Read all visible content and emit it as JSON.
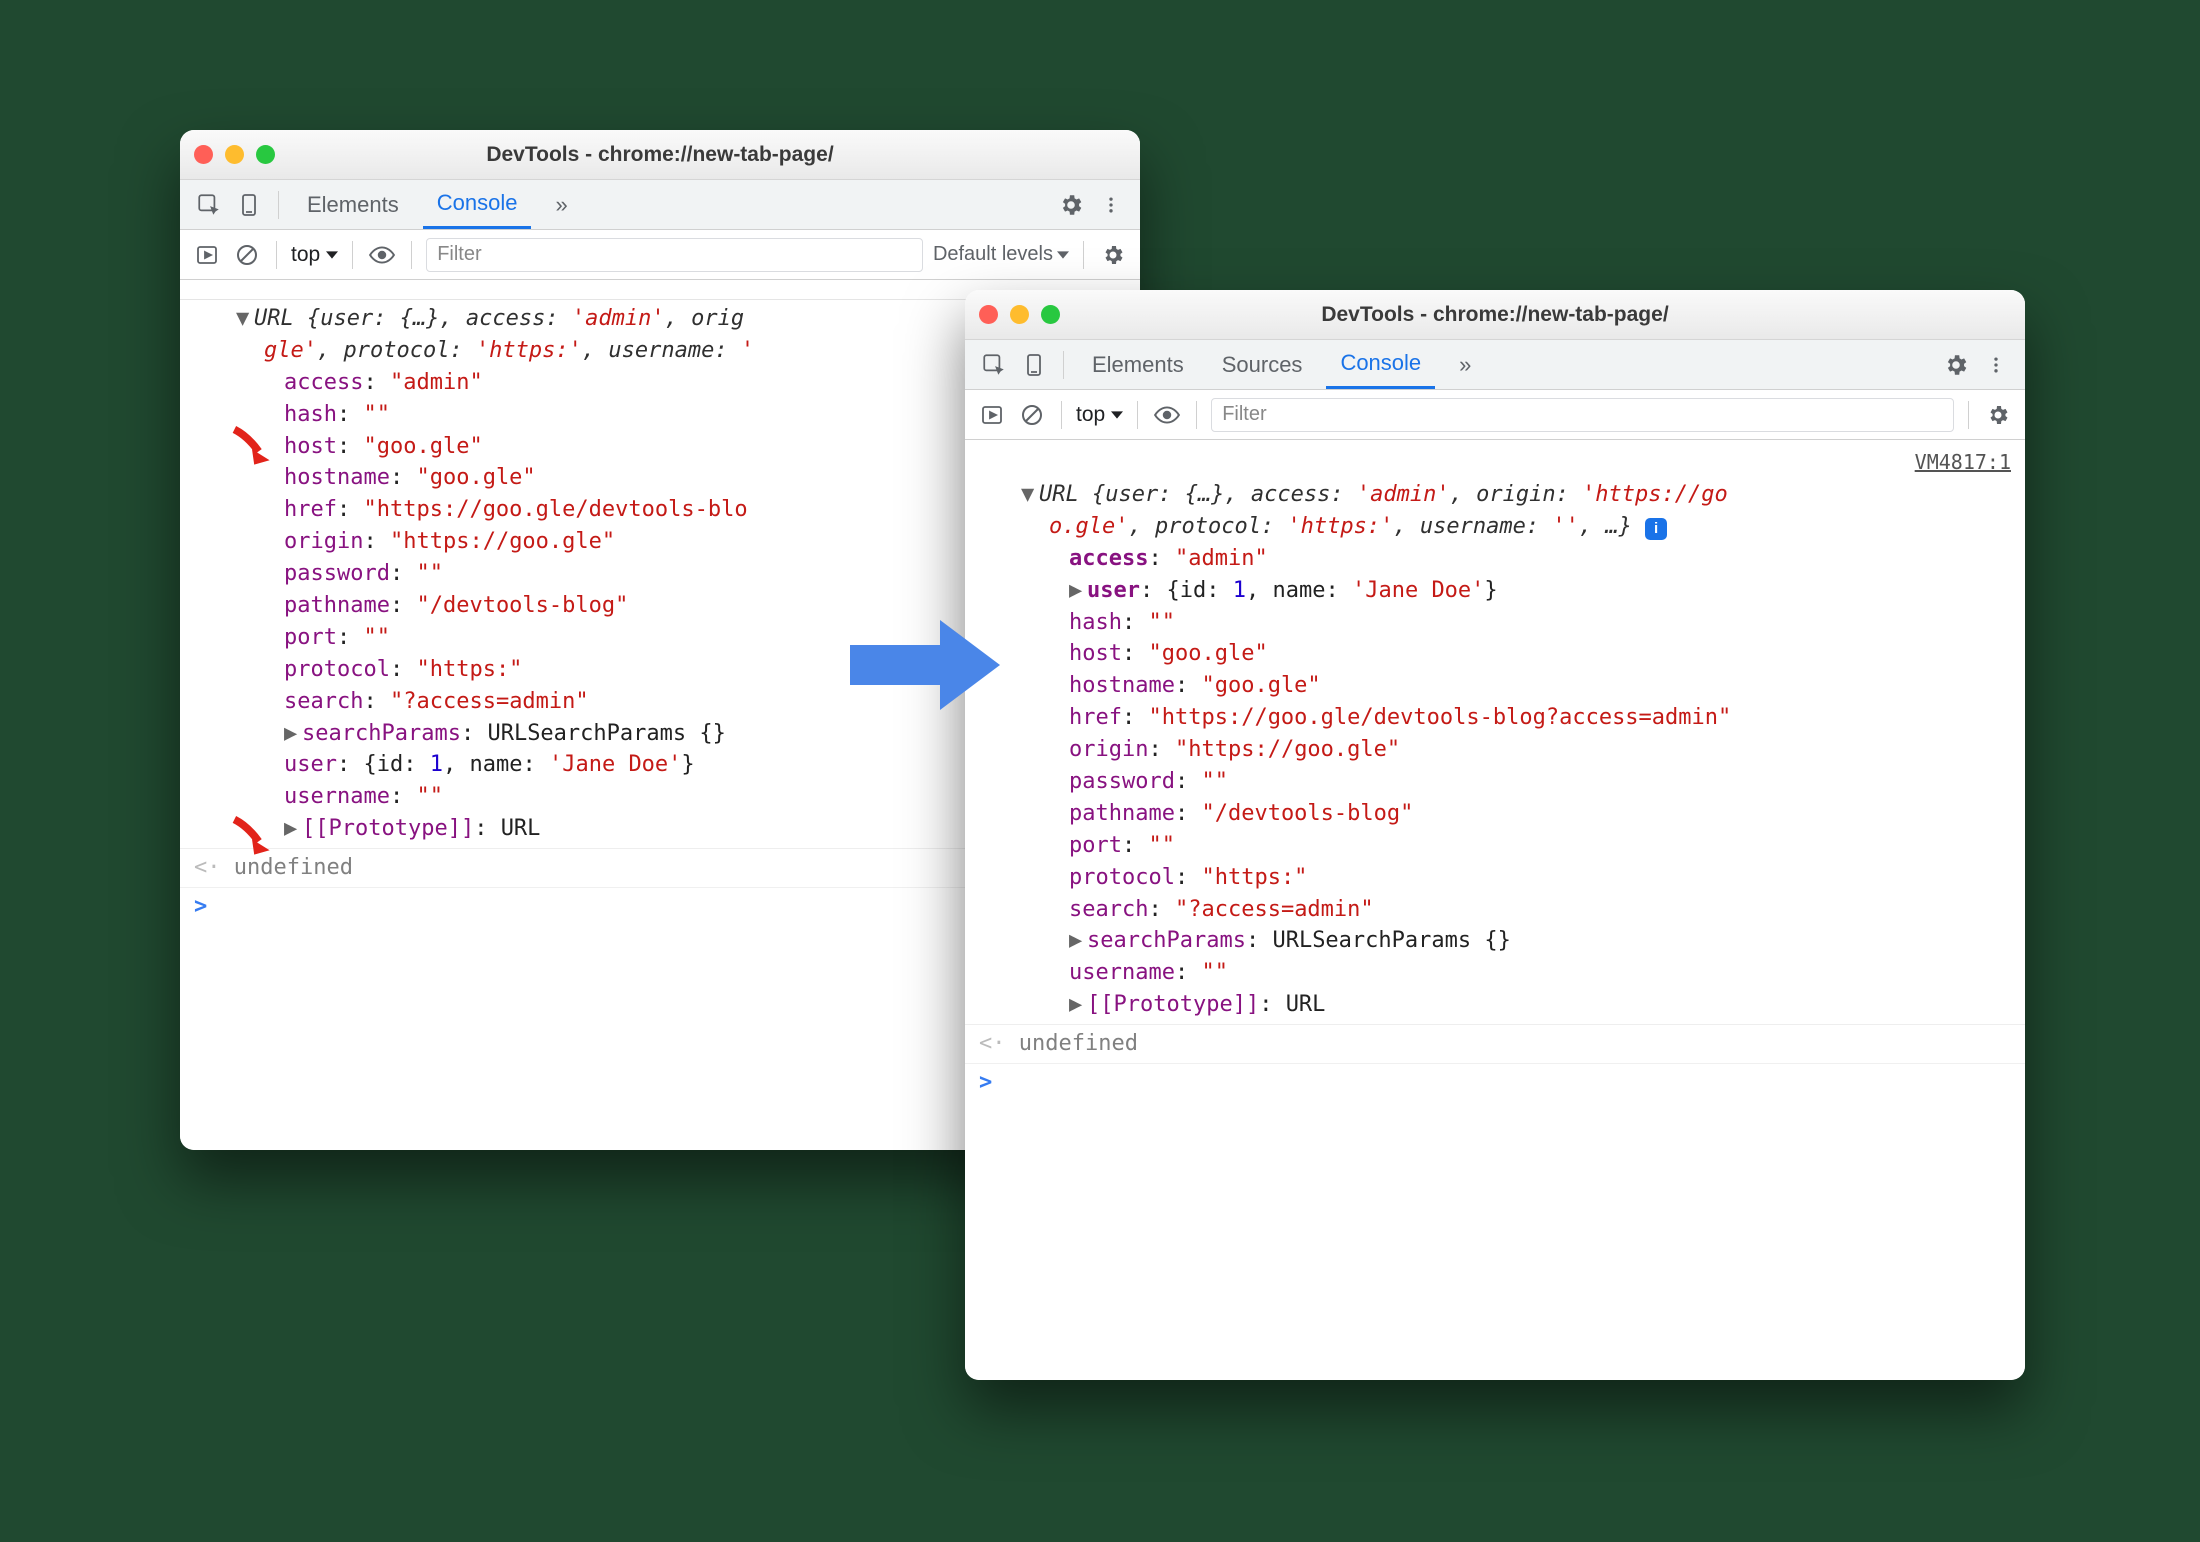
{
  "shared": {
    "title_prefix": "DevTools - ",
    "title_url": "chrome://new-tab-page/",
    "tabs": {
      "elements": "Elements",
      "sources": "Sources",
      "console": "Console",
      "more": "»"
    },
    "scope": "top",
    "filter_placeholder": "Filter",
    "default_levels": "Default levels",
    "undefined": "undefined"
  },
  "left": {
    "summary_line1_a": "URL {user: {…}, access: ",
    "summary_line1_b": "'admin'",
    "summary_line1_c": ", orig",
    "summary_line2_a": "gle'",
    "summary_line2_b": ", protocol: ",
    "summary_line2_c": "'https:'",
    "summary_line2_d": ", username: ",
    "summary_line2_e": "'",
    "props": [
      {
        "k": "access",
        "v": "\"admin\"",
        "red": true
      },
      {
        "k": "hash",
        "v": "\"\""
      },
      {
        "k": "host",
        "v": "\"goo.gle\""
      },
      {
        "k": "hostname",
        "v": "\"goo.gle\""
      },
      {
        "k": "href",
        "v": "\"https://goo.gle/devtools-blo"
      },
      {
        "k": "origin",
        "v": "\"https://goo.gle\""
      },
      {
        "k": "password",
        "v": "\"\""
      },
      {
        "k": "pathname",
        "v": "\"/devtools-blog\""
      },
      {
        "k": "port",
        "v": "\"\""
      },
      {
        "k": "protocol",
        "v": "\"https:\""
      },
      {
        "k": "search",
        "v": "\"?access=admin\""
      }
    ],
    "searchParams_k": "searchParams",
    "searchParams_v": "URLSearchParams {}",
    "user_k": "user",
    "user_id_k": "id",
    "user_id_v": "1",
    "user_name_k": "name",
    "user_name_v": "'Jane Doe'",
    "username_k": "username",
    "username_v": "\"\"",
    "proto_k": "[[Prototype]]",
    "proto_v": "URL"
  },
  "right": {
    "vm": "VM4817:1",
    "summary_line1_a": "URL {user: {…}, access: ",
    "summary_line1_b": "'admin'",
    "summary_line1_c": ", origin: ",
    "summary_line1_d": "'https://go",
    "summary_line2_a": "o.gle'",
    "summary_line2_b": ", protocol: ",
    "summary_line2_c": "'https:'",
    "summary_line2_d": ", username: ",
    "summary_line2_e": "''",
    "summary_line2_f": ", …}",
    "access_k": "access",
    "access_v": "\"admin\"",
    "user_k": "user",
    "user_id_k": "id",
    "user_id_v": "1",
    "user_name_k": "name",
    "user_name_v": "'Jane Doe'",
    "props": [
      {
        "k": "hash",
        "v": "\"\""
      },
      {
        "k": "host",
        "v": "\"goo.gle\""
      },
      {
        "k": "hostname",
        "v": "\"goo.gle\""
      },
      {
        "k": "href",
        "v": "\"https://goo.gle/devtools-blog?access=admin\""
      },
      {
        "k": "origin",
        "v": "\"https://goo.gle\""
      },
      {
        "k": "password",
        "v": "\"\""
      },
      {
        "k": "pathname",
        "v": "\"/devtools-blog\""
      },
      {
        "k": "port",
        "v": "\"\""
      },
      {
        "k": "protocol",
        "v": "\"https:\""
      },
      {
        "k": "search",
        "v": "\"?access=admin\""
      }
    ],
    "searchParams_k": "searchParams",
    "searchParams_v": "URLSearchParams {}",
    "username_k": "username",
    "username_v": "\"\"",
    "proto_k": "[[Prototype]]",
    "proto_v": "URL"
  }
}
